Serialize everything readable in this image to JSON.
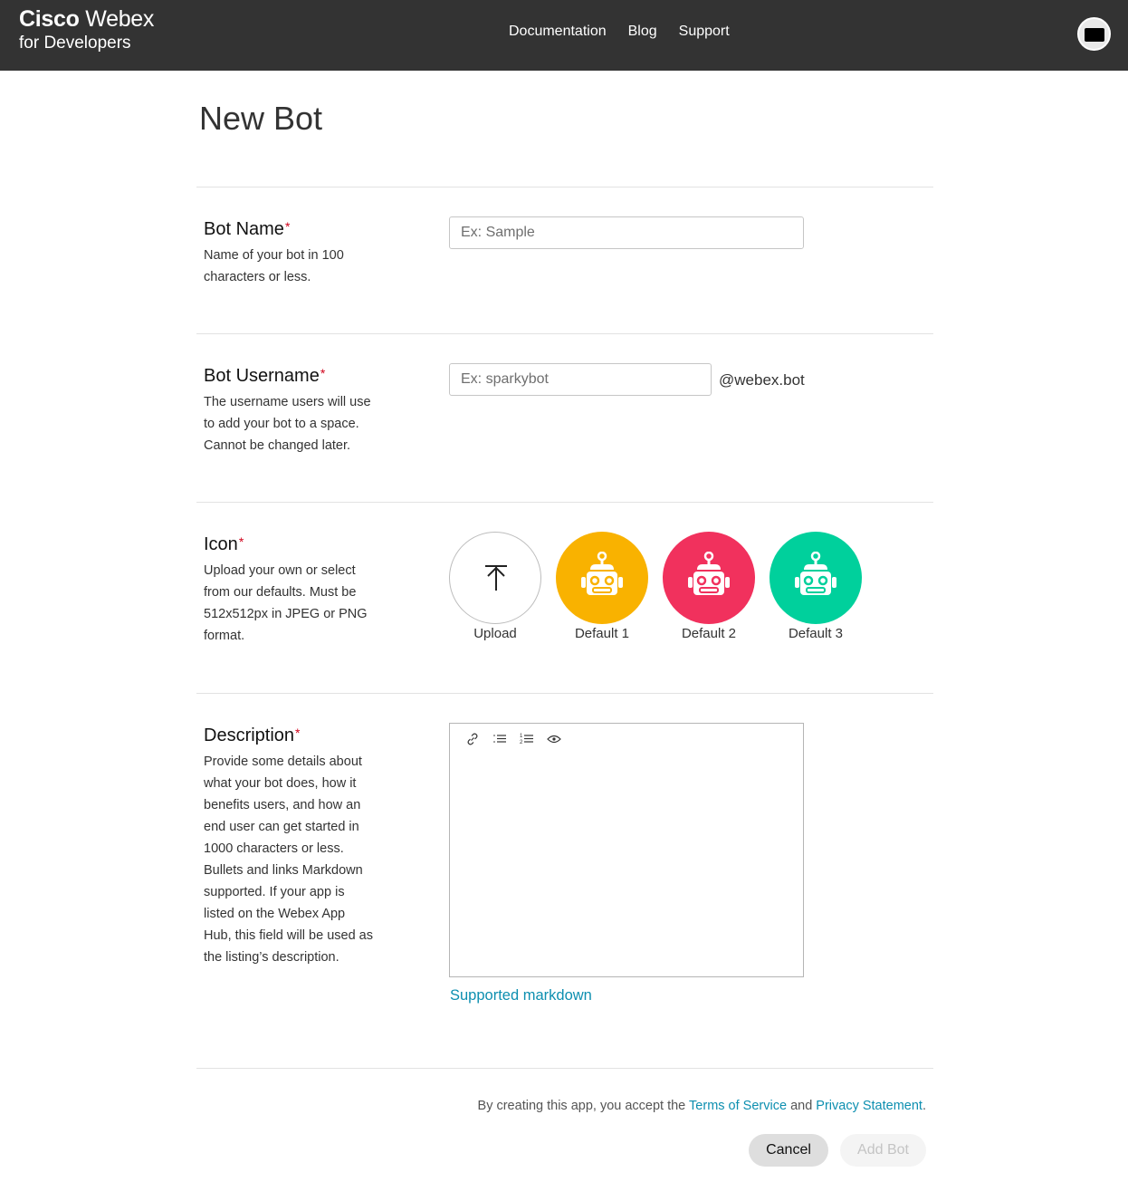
{
  "header": {
    "brand_bold": "Cisco",
    "brand_light": "Webex",
    "brand_sub": "for Developers",
    "nav": [
      {
        "label": "Documentation"
      },
      {
        "label": "Blog"
      },
      {
        "label": "Support"
      }
    ],
    "avatar_icon": "user-avatar-icon"
  },
  "page": {
    "title": "New Bot"
  },
  "form": {
    "required_mark": "*",
    "bot_name": {
      "label": "Bot Name",
      "help": "Name of your bot in 100 characters or less.",
      "placeholder": "Ex: Sample",
      "value": ""
    },
    "bot_username": {
      "label": "Bot Username",
      "help": "The username users will use to add your bot to a space. Cannot be changed later.",
      "placeholder": "Ex: sparkybot",
      "value": "",
      "suffix": "@webex.bot"
    },
    "icon": {
      "label": "Icon",
      "help": "Upload your own or select from our defaults. Must be 512x512px in JPEG or PNG format.",
      "options": [
        {
          "label": "Upload",
          "icon": "upload-arrow-icon",
          "color": "#ffffff"
        },
        {
          "label": "Default 1",
          "icon": "robot-icon",
          "color": "#f9b200"
        },
        {
          "label": "Default 2",
          "icon": "robot-icon",
          "color": "#f1315d"
        },
        {
          "label": "Default 3",
          "icon": "robot-icon",
          "color": "#00d09c"
        }
      ]
    },
    "description": {
      "label": "Description",
      "help": "Provide some details about what your bot does, how it benefits users, and how an end user can get started in 1000 characters or less. Bullets and links Markdown supported. If your app is listed on the Webex App Hub, this field will be used as the listing’s description.",
      "value": "",
      "toolbar": [
        "link-icon",
        "bulleted-list-icon",
        "numbered-list-icon",
        "preview-eye-icon"
      ],
      "markdown_link": "Supported markdown"
    }
  },
  "footer": {
    "legal_prefix": "By creating this app, you accept the",
    "terms_link": "Terms of Service",
    "legal_and": "and",
    "privacy_link": "Privacy Statement",
    "legal_suffix": ".",
    "cancel_label": "Cancel",
    "add_label": "Add Bot"
  },
  "colors": {
    "header_bg": "#333333",
    "link": "#0d8fb0",
    "required": "#d0021b"
  }
}
